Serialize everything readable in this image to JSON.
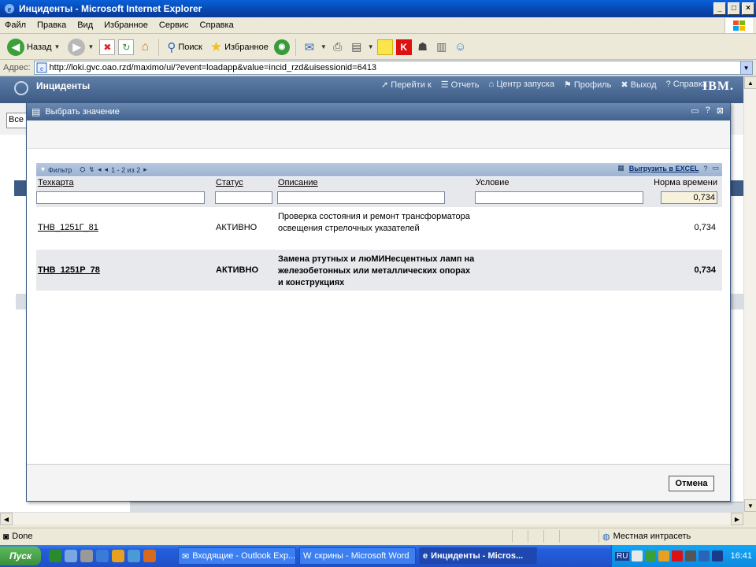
{
  "window": {
    "title": "Инциденты - Microsoft Internet Explorer",
    "controls": {
      "minimize": "_",
      "maximize": "□",
      "close": "×"
    }
  },
  "menu": {
    "items": [
      "Файл",
      "Правка",
      "Вид",
      "Избранное",
      "Сервис",
      "Справка"
    ]
  },
  "toolbar": {
    "back_label": "Назад",
    "search_label": "Поиск",
    "favorites_label": "Избранное"
  },
  "address": {
    "label": "Адрес:",
    "url": "http://loki.gvc.oao.rzd/maximo/ui/?event=loadapp&value=incid_rzd&uisessionid=6413"
  },
  "app": {
    "title": "Инциденты",
    "links": [
      "Перейти к",
      "Отчеть",
      "Центр запуска",
      "Профиль",
      "Выход",
      "Справка"
    ],
    "brand": "IBM.",
    "bg_all": "Все"
  },
  "dialog": {
    "title": "Выбрать значение",
    "controls": [
      "▭",
      "?",
      "⊠"
    ],
    "table_toolbar": {
      "filter_label": "Фильтр",
      "pagination": "1 - 2 из 2",
      "export_label": "Выгрузить в EXCEL",
      "help": "?"
    },
    "columns": [
      "Техкарта",
      "Статус",
      "Описание",
      "Условие",
      "Норма времени"
    ],
    "filter_values": {
      "norm": "0,734"
    },
    "rows": [
      {
        "code": "ТНВ_1251Г_81",
        "status": "АКТИВНО",
        "description": "Проверка состояния и ремонт трансформатора освещения стрелочных указателей",
        "condition": "",
        "norm": "0,734"
      },
      {
        "code": "ТНВ_1251Р_78",
        "status": "АКТИВНО",
        "description": "Замена ртутных и люМИНесцентных ламп на железобетонных или металлических опорах и конструкциях",
        "condition": "",
        "norm": "0,734"
      }
    ],
    "cancel_label": "Отмена"
  },
  "status": {
    "left": "Done",
    "zone": "Местная интрасеть"
  },
  "taskbar": {
    "start": "Пуск",
    "tasks": [
      "Входящие - Outlook Exp...",
      "скрины - Microsoft Word",
      "Инциденты - Micros..."
    ],
    "lang": "RU",
    "clock": "16:41"
  },
  "colors": {
    "accent": "#3c5a84",
    "titlebar": "#0a5fd8",
    "row_alt": "#e7e9ec"
  }
}
